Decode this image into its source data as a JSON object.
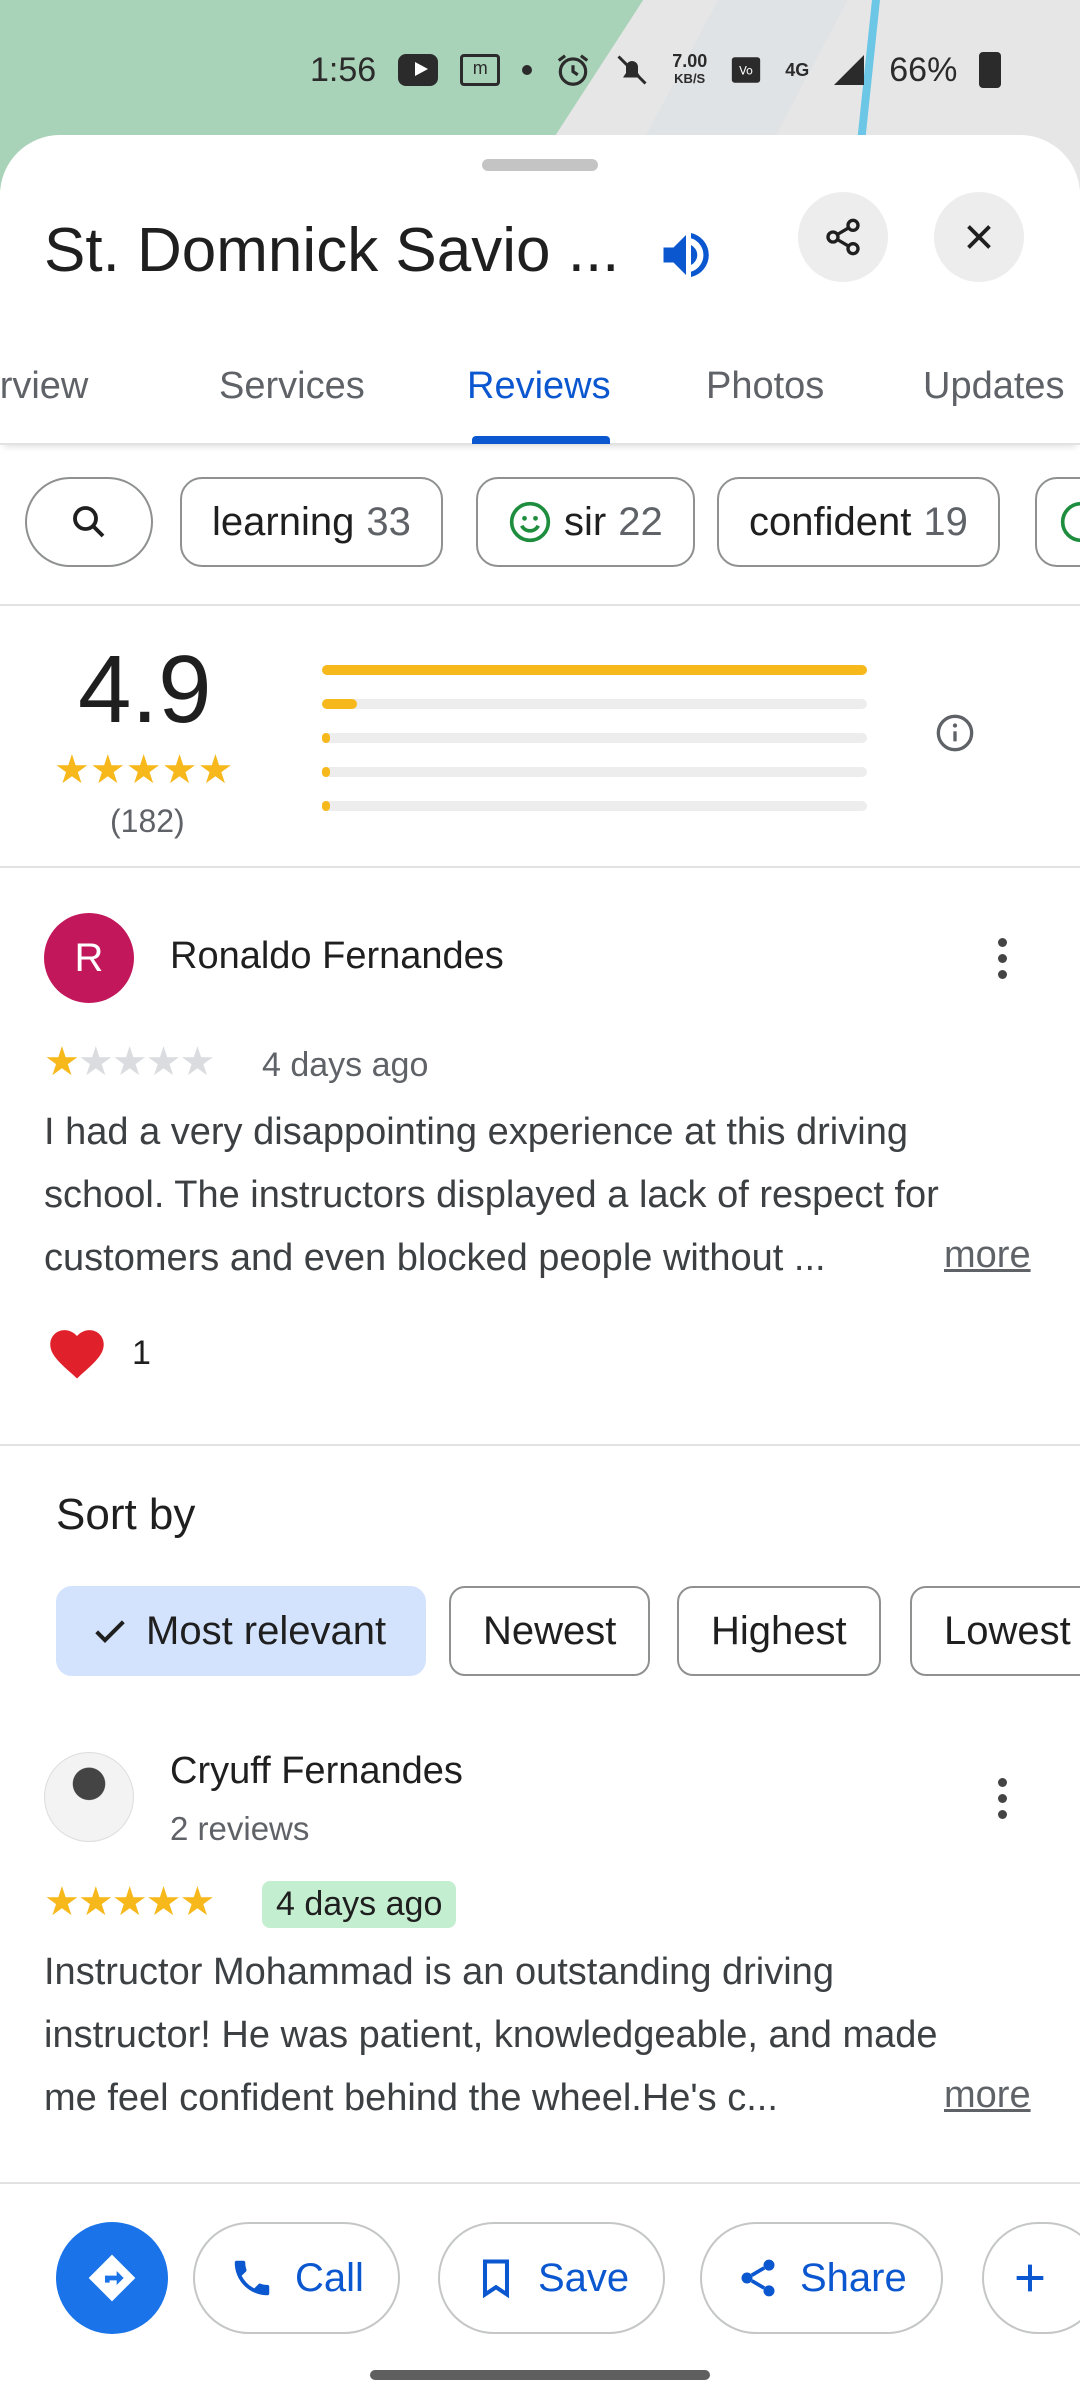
{
  "status_bar": {
    "time": "1:56",
    "net_speed_value": "7.00",
    "net_speed_unit": "KB/S",
    "network_label": "4G",
    "battery": "66%"
  },
  "place": {
    "title": "St. Domnick Savio ..."
  },
  "tabs": [
    {
      "label": "Overview"
    },
    {
      "label": "Services"
    },
    {
      "label": "Reviews",
      "active": true
    },
    {
      "label": "Photos"
    },
    {
      "label": "Updates"
    }
  ],
  "topic_chips": [
    {
      "label": "learning",
      "count": "33"
    },
    {
      "label": "sir",
      "count": "22"
    },
    {
      "label": "confident",
      "count": "19"
    }
  ],
  "rating_summary": {
    "average": "4.9",
    "review_count": "(182)",
    "distribution": [
      {
        "stars": 5,
        "fraction": 1.0
      },
      {
        "stars": 4,
        "fraction": 0.065
      },
      {
        "stars": 3,
        "fraction": 0.01
      },
      {
        "stars": 2,
        "fraction": 0.0
      },
      {
        "stars": 1,
        "fraction": 0.015
      }
    ]
  },
  "reviews": [
    {
      "avatar_letter": "R",
      "name": "Ronaldo Fernandes",
      "rating": 1,
      "date": "4 days ago",
      "text": "I had a very disappointing experience at this driving school. The instructors displayed a lack of respect for customers and even blocked people without ...",
      "more": "more",
      "reaction_count": "1"
    },
    {
      "name": "Cryuff Fernandes",
      "subtitle": "2 reviews",
      "rating": 5,
      "date": "4 days ago",
      "text": "Instructor Mohammad is an outstanding driving instructor! He was patient, knowledgeable, and made me feel confident behind the wheel.He's c...",
      "more": "more"
    }
  ],
  "sort": {
    "title": "Sort by",
    "options": [
      {
        "label": "Most relevant",
        "selected": true
      },
      {
        "label": "Newest"
      },
      {
        "label": "Highest"
      },
      {
        "label": "Lowest"
      }
    ]
  },
  "actions": {
    "call": "Call",
    "save": "Save",
    "share": "Share"
  },
  "colors": {
    "accent": "#0b57d0",
    "star": "#f6b81b",
    "avatar_r": "#c2185b",
    "chip_selected": "#d3e3fd",
    "date_badge": "#c4eed0"
  }
}
